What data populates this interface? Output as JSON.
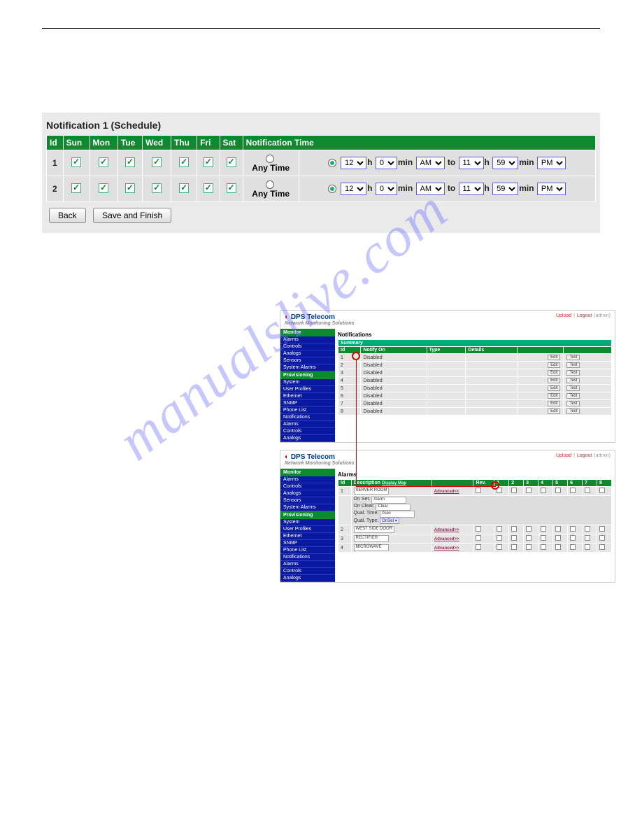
{
  "watermark": "manualslive.com",
  "schedule": {
    "title": "Notification 1 (Schedule)",
    "headers": [
      "Id",
      "Sun",
      "Mon",
      "Tue",
      "Wed",
      "Thu",
      "Fri",
      "Sat",
      "Notification Time"
    ],
    "anytime_label": "Any Time",
    "h_label": "h",
    "min_label": "min",
    "to_label": "to",
    "rows": [
      {
        "id": "1",
        "days": [
          true,
          true,
          true,
          true,
          true,
          true,
          true
        ],
        "anytime": false,
        "from_h": "12",
        "from_m": "0",
        "from_ap": "AM",
        "to_h": "11",
        "to_m": "59",
        "to_ap": "PM"
      },
      {
        "id": "2",
        "days": [
          true,
          true,
          true,
          true,
          true,
          true,
          true
        ],
        "anytime": false,
        "from_h": "12",
        "from_m": "0",
        "from_ap": "AM",
        "to_h": "11",
        "to_m": "59",
        "to_ap": "PM"
      }
    ],
    "buttons": {
      "back": "Back",
      "save": "Save and Finish"
    }
  },
  "sub": {
    "brand": "DPS Telecom",
    "brand_sub": "Network Monitoring Solutions",
    "toplinks": [
      "Upload",
      "Logout",
      "(admin)"
    ],
    "sidebar_groups": [
      {
        "head": "Monitor",
        "items": [
          "Alarms",
          "Controls",
          "Analogs",
          "Sensors",
          "System Alarms"
        ]
      },
      {
        "head": "Provisioning",
        "items": [
          "System",
          "User Profiles",
          "Ethernet",
          "SNMP",
          "Phone List",
          "Notifications",
          "Alarms",
          "Controls",
          "Analogs"
        ]
      }
    ],
    "notif": {
      "title": "Notifications",
      "tab": "Summary",
      "cols": [
        "Id",
        "Notify On",
        "Type",
        "Details"
      ],
      "rows": [
        {
          "id": "1",
          "status": "Disabled"
        },
        {
          "id": "2",
          "status": "Disabled"
        },
        {
          "id": "3",
          "status": "Disabled"
        },
        {
          "id": "4",
          "status": "Disabled"
        },
        {
          "id": "5",
          "status": "Disabled"
        },
        {
          "id": "6",
          "status": "Disabled"
        },
        {
          "id": "7",
          "status": "Disabled"
        },
        {
          "id": "8",
          "status": "Disabled"
        }
      ],
      "edit_btn": "Edit",
      "test_btn": "Test"
    },
    "alarms": {
      "title": "Alarms",
      "cols": [
        "Id",
        "Description",
        "Display Map",
        "",
        "Rev.",
        "1",
        "2",
        "3",
        "4",
        "5",
        "6",
        "7",
        "8"
      ],
      "desc_link": "Display Map",
      "adv_open": "Advanced<<",
      "adv_closed": "Advanced>>",
      "detail_labels": {
        "onset": "On Set:",
        "onclear": "On Clear:",
        "qualtime": "Qual. Time:",
        "qualtype": "Qual. Type:"
      },
      "detail_values": {
        "onset": "Alarm",
        "onclear": "Clear",
        "qualtime": "0sec",
        "qualtype": "OnSet"
      },
      "rows": [
        {
          "id": "1",
          "desc": "SERVER ROOM",
          "open": true
        },
        {
          "id": "2",
          "desc": "WEST SIDE DOOR",
          "open": false
        },
        {
          "id": "3",
          "desc": "RECTIFIER",
          "open": false
        },
        {
          "id": "4",
          "desc": "MICROWAVE",
          "open": false
        }
      ]
    }
  }
}
